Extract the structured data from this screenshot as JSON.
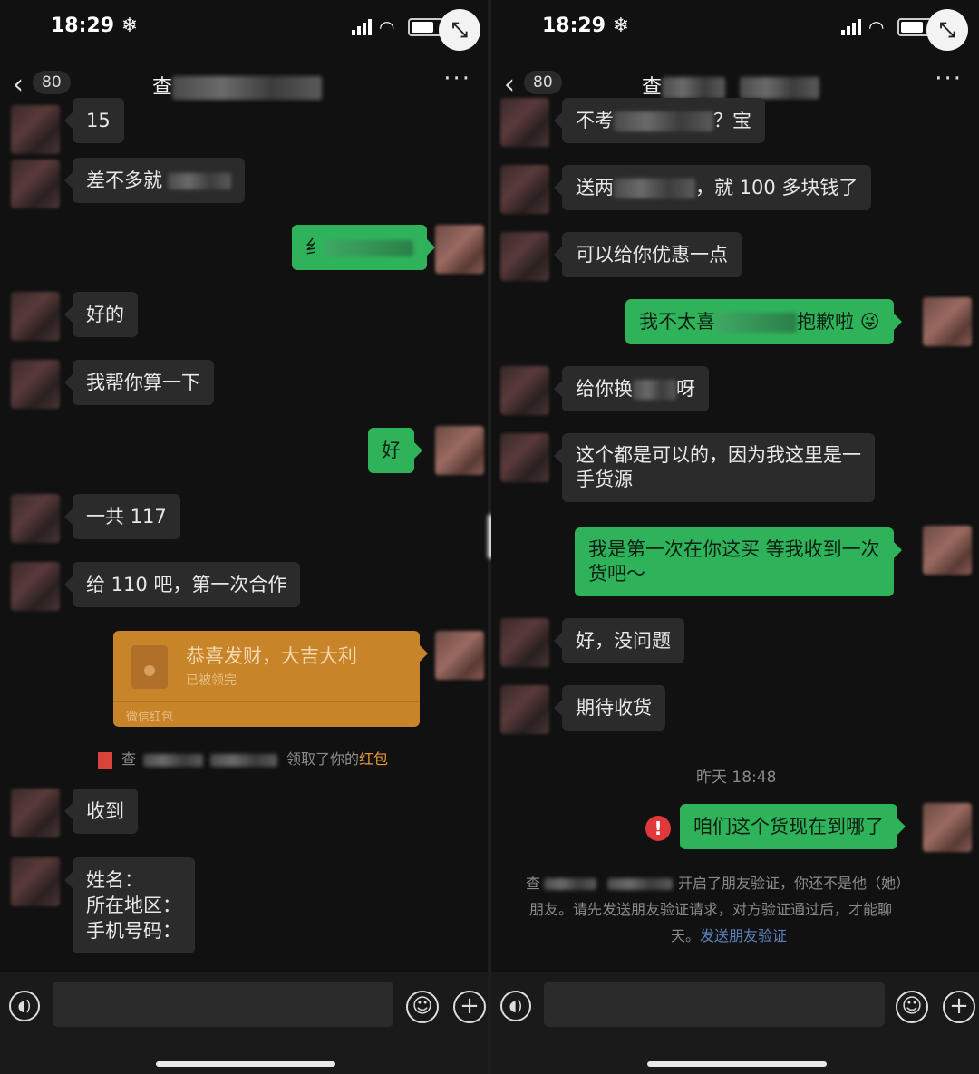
{
  "left": {
    "status_time": "18:29",
    "unread_count": "80",
    "title_char": "查",
    "messages": {
      "m1": "15",
      "m2": "差不多就",
      "m3": "纟",
      "m4": "好的",
      "m5": "我帮你算一下",
      "m6": "好",
      "m7": "一共 117",
      "m8": "给 110 吧，第一次合作",
      "m9": "收到",
      "m10": "姓名：\n所在地区：\n手机号码："
    },
    "red_packet": {
      "title": "恭喜发财，大吉大利",
      "status": "已被领完",
      "footer": "微信红包"
    },
    "receipt": {
      "prefix": "查",
      "text": "领取了你的",
      "highlight": "红包"
    }
  },
  "right": {
    "status_time": "18:29",
    "unread_count": "80",
    "title_char": "查",
    "messages": {
      "m1a": "不考",
      "m1b": "？宝",
      "m2a": "送两",
      "m2b": "，就 100 多块钱了",
      "m3": "可以给你优惠一点",
      "m4a": "我不太喜",
      "m4b": "抱歉啦",
      "m4emoji": "😜",
      "m5a": "给你换",
      "m5b": "呀",
      "m6": "这个都是可以的，因为我这里是一\n手货源",
      "m7": "我是第一次在你这买 等我收到一次\n货吧～",
      "m8": "好，没问题",
      "m9": "期待收货",
      "m10": "咱们这个货现在到哪了"
    },
    "timestamp": "昨天 18:48",
    "system_notice": {
      "line1_prefix": "查",
      "line1": "开启了朋友验证，你还不是他（她）",
      "line2": "朋友。请先发送朋友验证请求，对方验证通过后，才能聊",
      "line3_prefix": "天。",
      "link": "发送朋友验证"
    }
  },
  "icons": {
    "back": "chevron-left-icon",
    "more": "more-icon",
    "voice": "voice-icon",
    "emoji": "emoji-icon",
    "plus": "plus-icon",
    "expand": "expand-icon",
    "error": "error-icon"
  },
  "colors": {
    "background": "#111111",
    "incoming_bubble": "#2b2b2b",
    "outgoing_bubble": "#2fb35a",
    "red_packet": "#c88428",
    "error": "#e0383b",
    "link": "#5b82b8"
  }
}
